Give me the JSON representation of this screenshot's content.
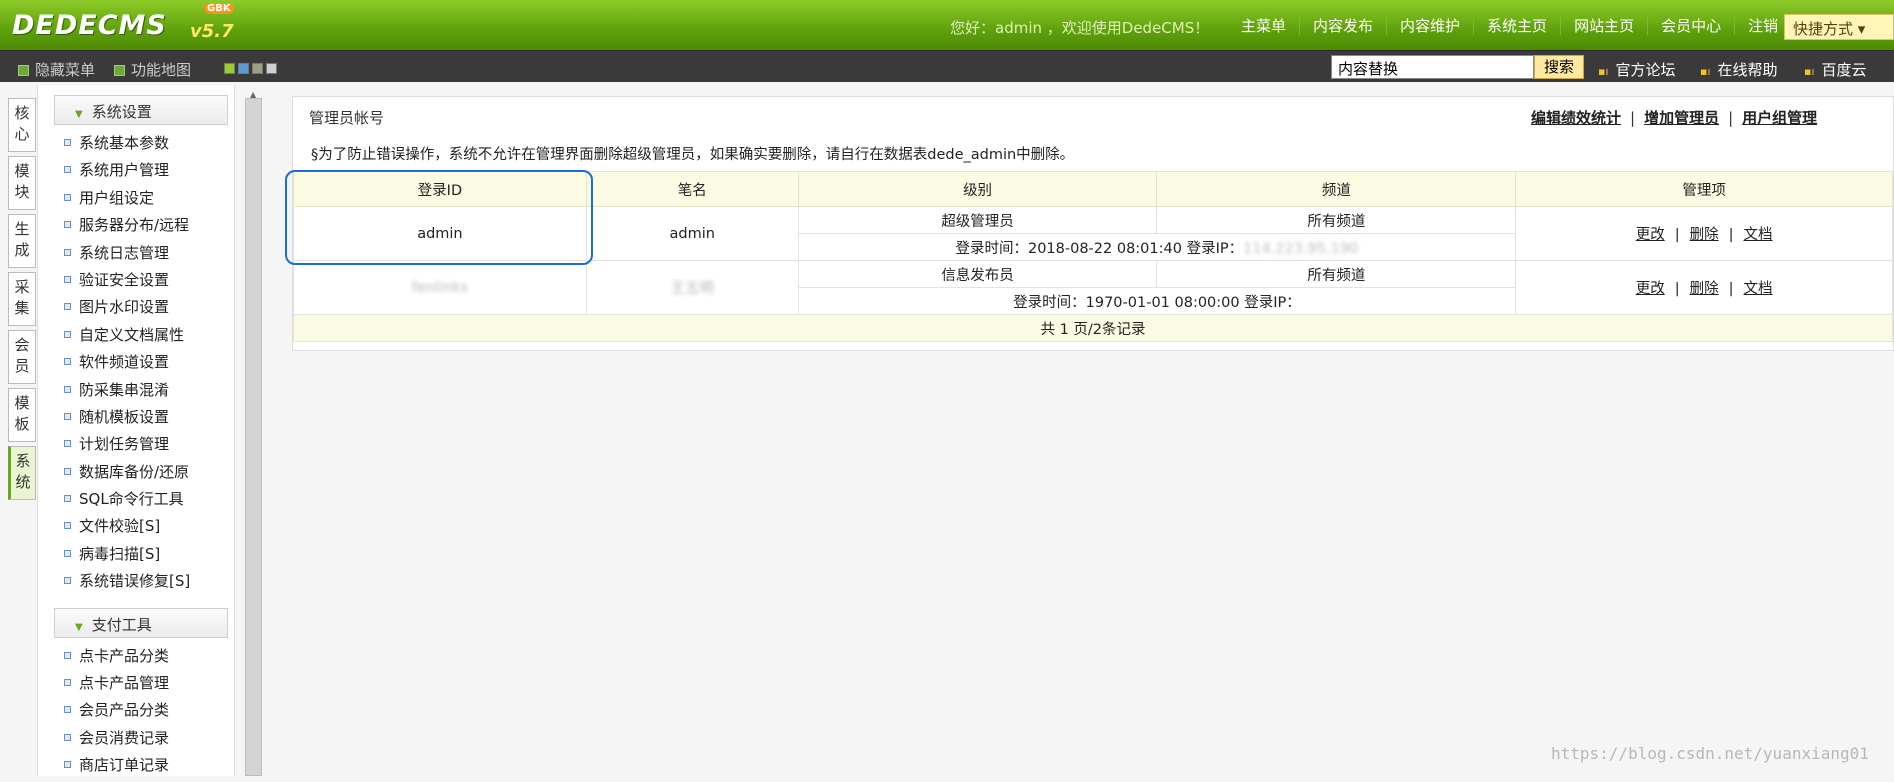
{
  "header": {
    "logo": "DEDECMS",
    "version": "v5.7",
    "badge": "GBK",
    "welcome": "您好：admin ，欢迎使用DedeCMS！",
    "nav": [
      "主菜单",
      "内容发布",
      "内容维护",
      "系统主页",
      "网站主页",
      "会员中心",
      "注销"
    ],
    "quick": "快捷方式"
  },
  "subbar": {
    "hide_menu": "隐藏菜单",
    "func_map": "功能地图",
    "search_value": "内容替换",
    "search_button": "搜索",
    "links": [
      "官方论坛",
      "在线帮助",
      "百度云"
    ]
  },
  "sidetabs": [
    "核心",
    "模块",
    "生成",
    "采集",
    "会员",
    "模板",
    "系统"
  ],
  "menu": {
    "section1": "系统设置",
    "items1": [
      "系统基本参数",
      "系统用户管理",
      "用户组设定",
      "服务器分布/远程",
      "系统日志管理",
      "验证安全设置",
      "图片水印设置",
      "自定义文档属性",
      "软件频道设置",
      "防采集串混淆",
      "随机模板设置",
      "计划任务管理",
      "数据库备份/还原",
      "SQL命令行工具",
      "文件校验[S]",
      "病毒扫描[S]",
      "系统错误修复[S]"
    ],
    "section2": "支付工具",
    "items2": [
      "点卡产品分类",
      "点卡产品管理",
      "会员产品分类",
      "会员消费记录",
      "商店订单记录"
    ]
  },
  "panel": {
    "title": "管理员帐号",
    "links": [
      "编辑绩效统计",
      "增加管理员",
      "用户组管理"
    ],
    "notice": "§为了防止错误操作，系统不允许在管理界面删除超级管理员，如果确实要删除，请自行在数据表dede_admin中删除。",
    "columns": [
      "登录ID",
      "笔名",
      "级别",
      "频道",
      "管理项"
    ],
    "rows": [
      {
        "id": "admin",
        "pen": "admin",
        "level": "超级管理员",
        "channel": "所有频道",
        "login": "登录时间：2018-08-22 08:01:40  登录IP：",
        "ip": "114.223.95.190"
      },
      {
        "id": "fenlinks",
        "pen": "王五明",
        "level": "信息发布员",
        "channel": "所有频道",
        "login": "登录时间：1970-01-01 08:00:00  登录IP：",
        "ip": ""
      }
    ],
    "ops": [
      "更改",
      "删除",
      "文档"
    ],
    "pager": "共 1 页/2条记录"
  },
  "watermark": "https://blog.csdn.net/yuanxiang01"
}
